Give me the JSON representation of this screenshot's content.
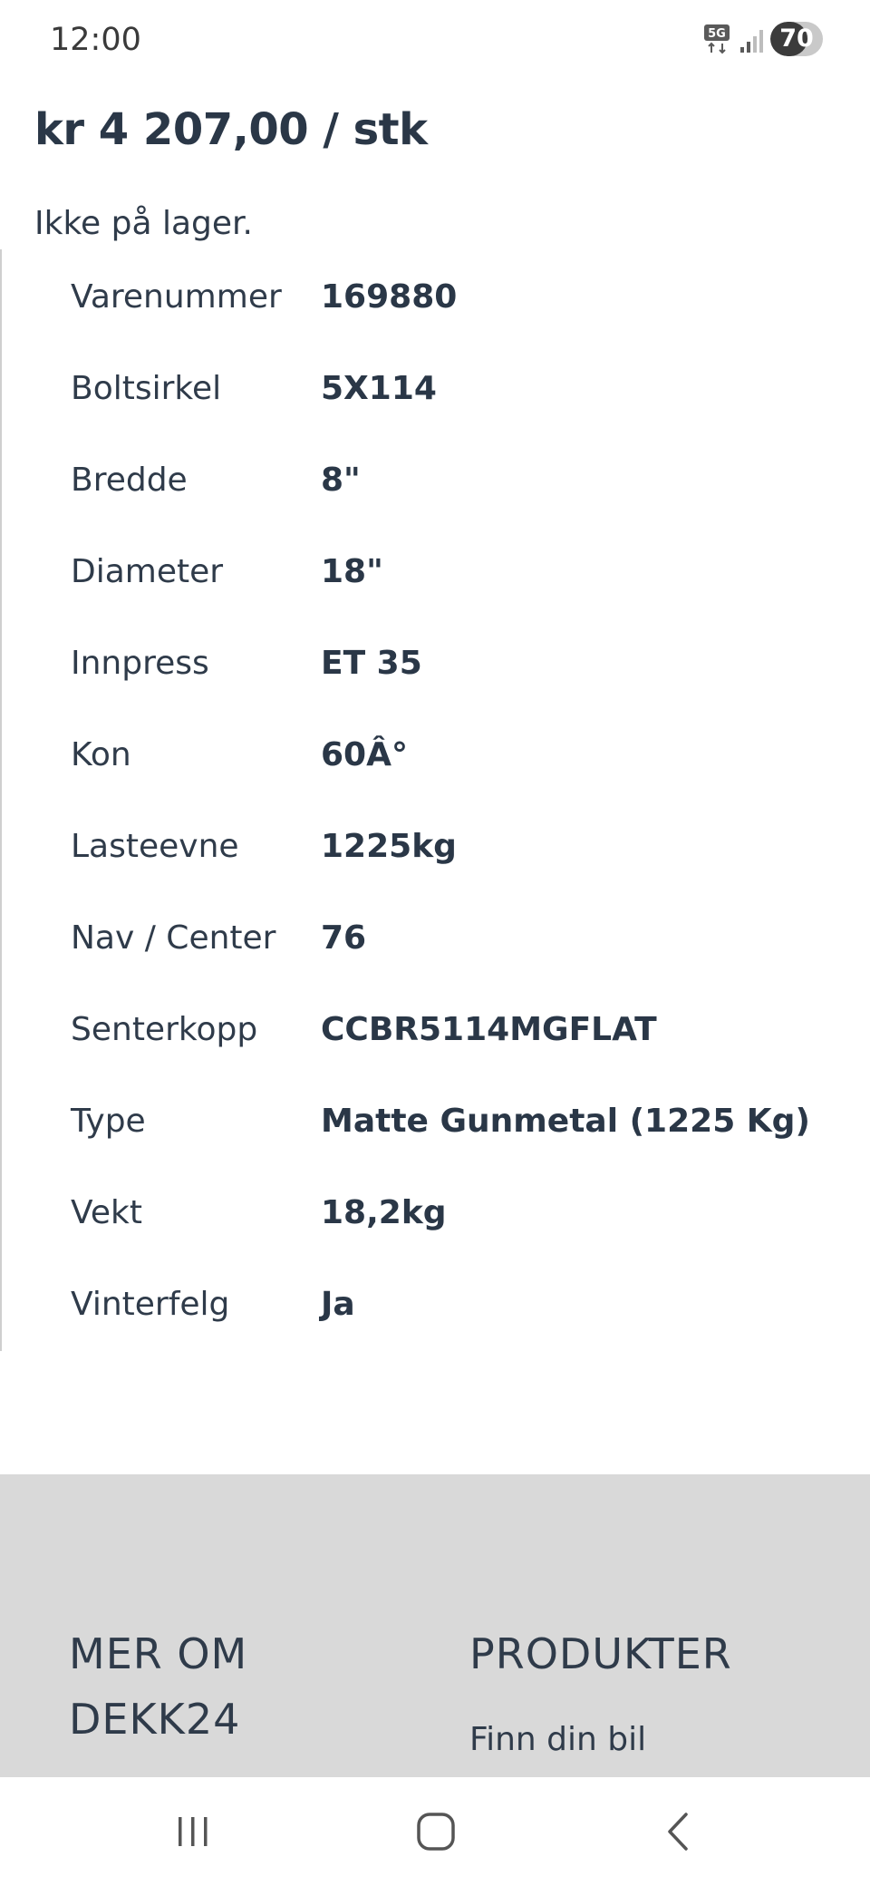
{
  "status_bar": {
    "time": "12:00",
    "network_icon": "5g-network-icon",
    "signal_icon": "signal-strength-icon",
    "battery_level": "70",
    "battery_fraction": 0.7
  },
  "product": {
    "price": "kr 4 207,00 / stk",
    "stock_status": "Ikke på lager."
  },
  "specs": [
    {
      "label": "Varenummer",
      "value": "169880"
    },
    {
      "label": "Boltsirkel",
      "value": "5X114"
    },
    {
      "label": "Bredde",
      "value": "8\""
    },
    {
      "label": "Diameter",
      "value": "18\""
    },
    {
      "label": "Innpress",
      "value": "ET 35"
    },
    {
      "label": "Kon",
      "value": "60Â°"
    },
    {
      "label": "Lasteevne",
      "value": "1225kg"
    },
    {
      "label": "Nav / Center",
      "value": "76"
    },
    {
      "label": "Senterkopp",
      "value": "CCBR5114MGFLAT"
    },
    {
      "label": "Type",
      "value": "Matte Gunmetal (1225 Kg)"
    },
    {
      "label": "Vekt",
      "value": "18,2kg"
    },
    {
      "label": "Vinterfelg",
      "value": "Ja"
    }
  ],
  "footer": {
    "col1_heading_line1": "MER OM",
    "col1_heading_line2": "DEKK24",
    "col2_heading": "PRODUKTER",
    "col2_links": [
      "Finn din bil"
    ]
  },
  "nav_bar": {
    "recents_icon": "recent-apps-icon",
    "home_icon": "home-icon",
    "back_icon": "back-icon"
  }
}
